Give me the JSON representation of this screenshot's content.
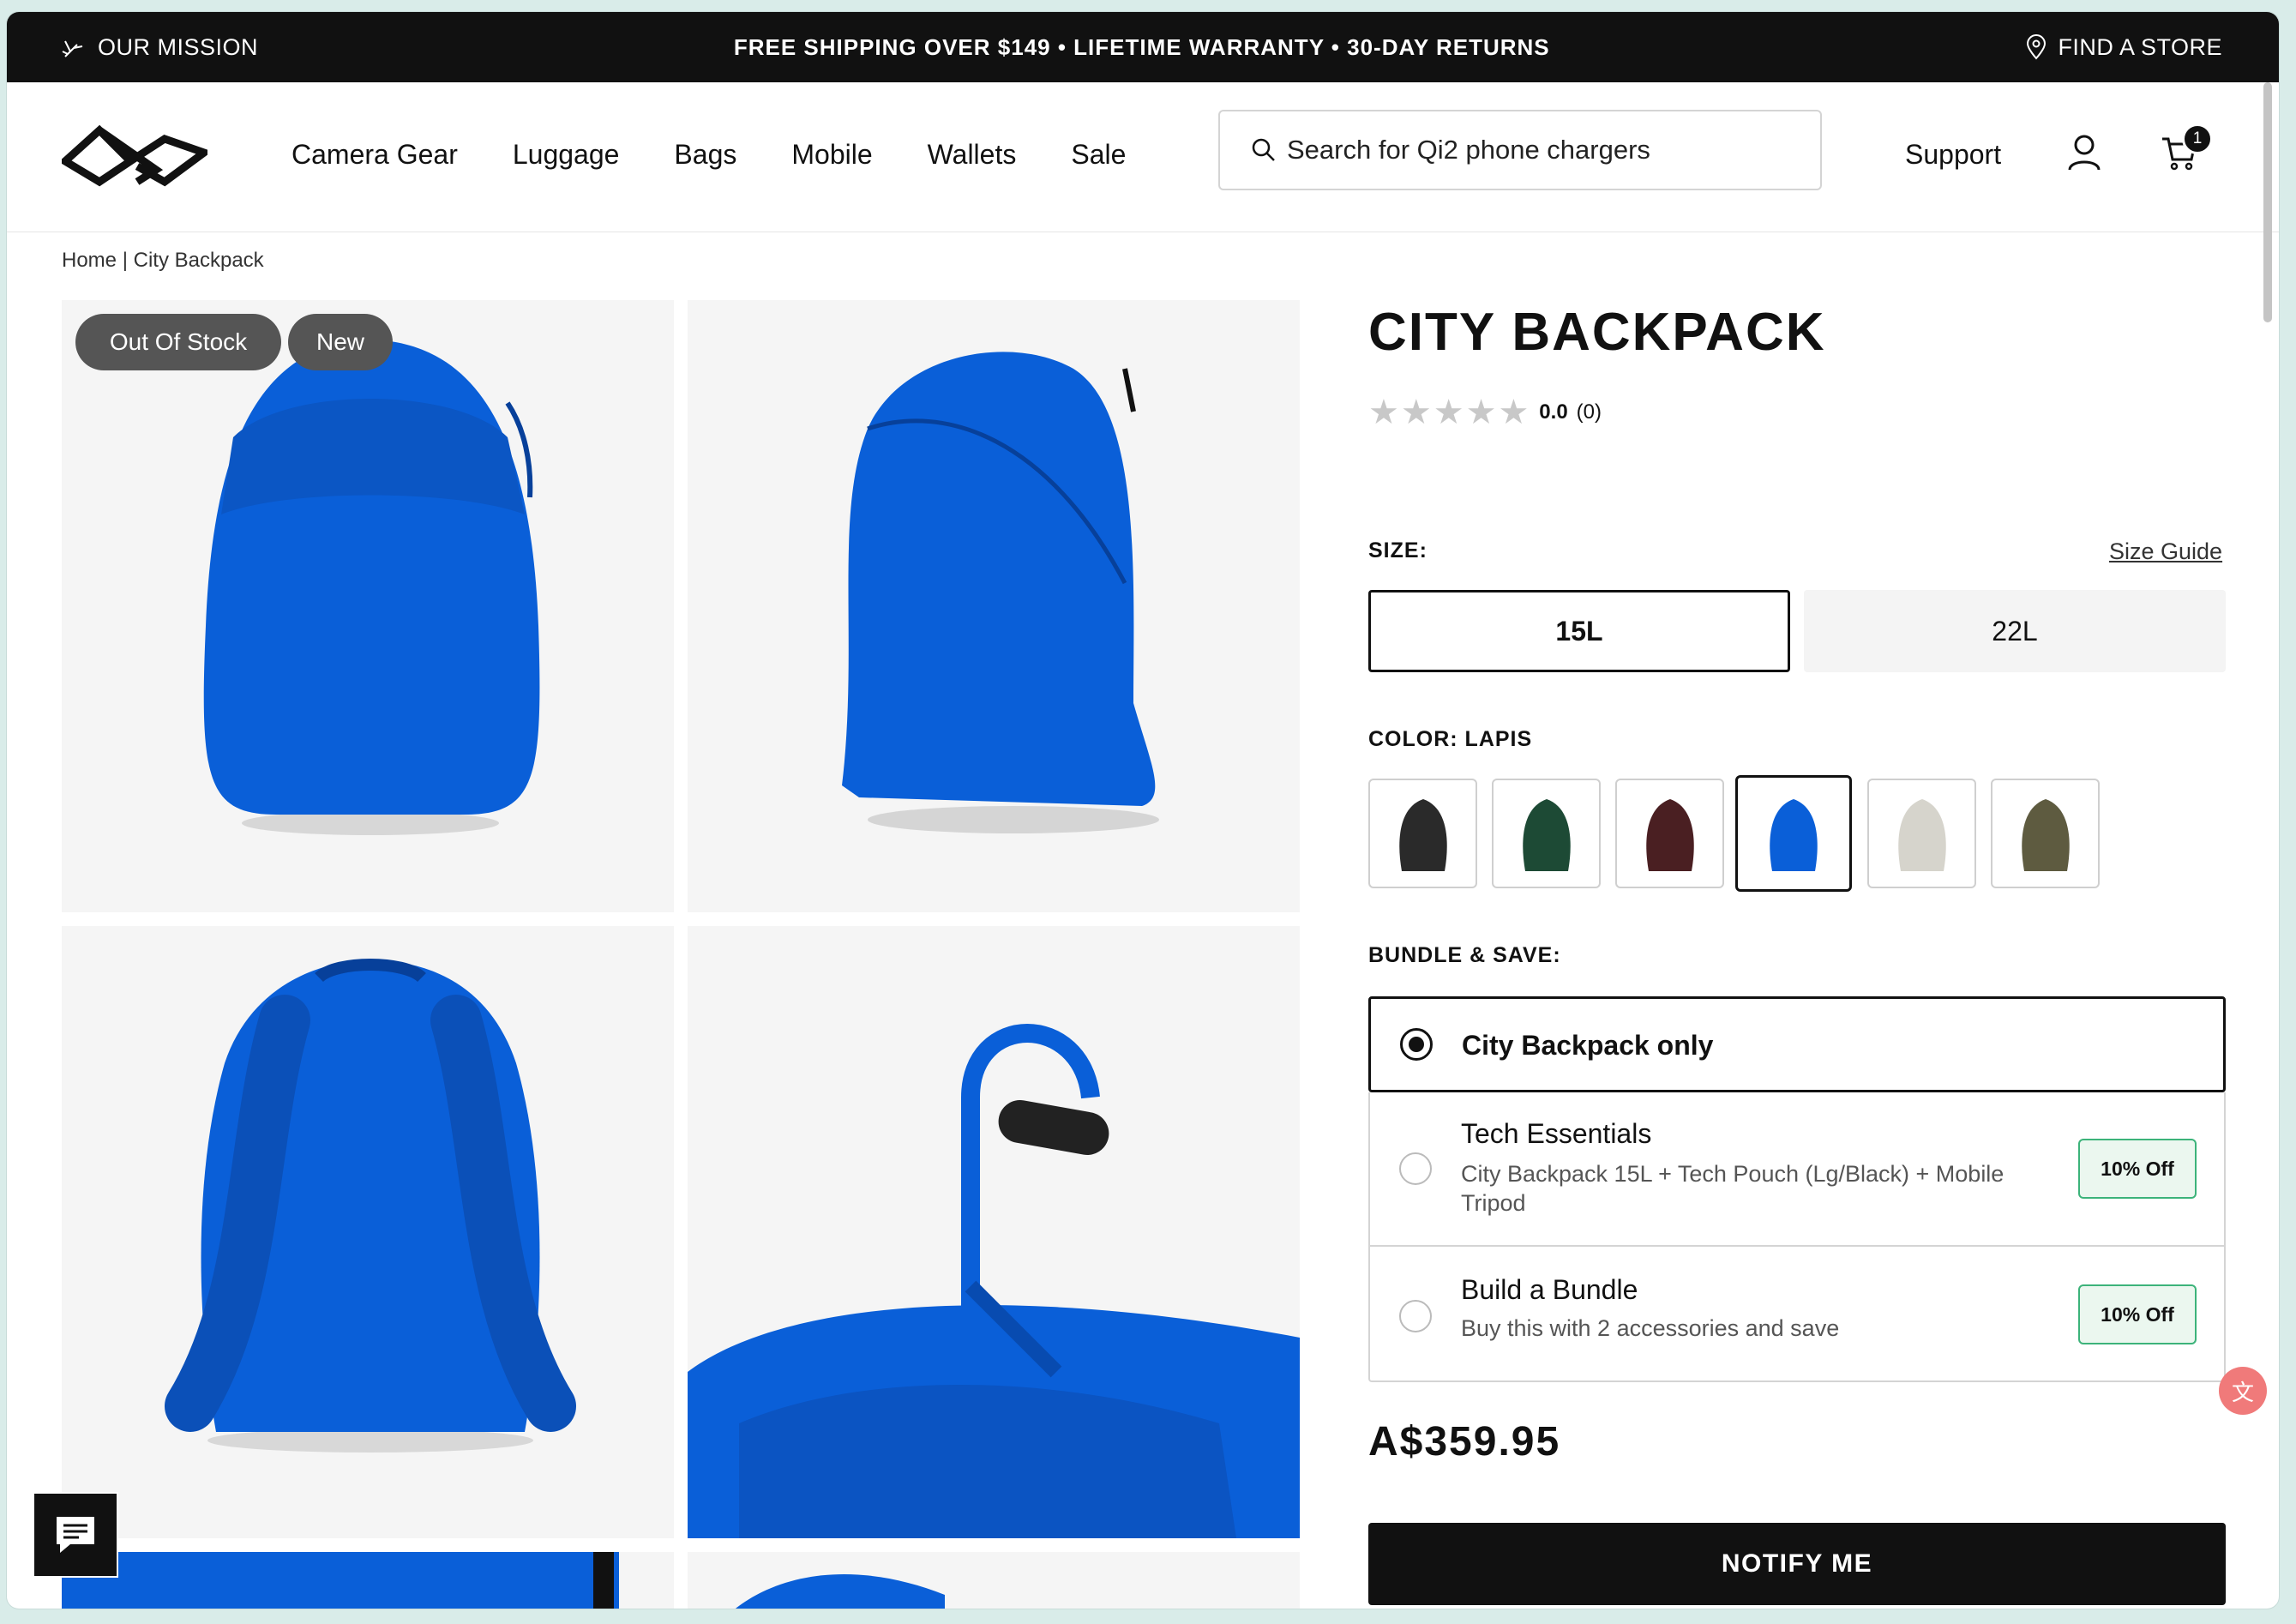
{
  "topbar": {
    "mission": "OUR MISSION",
    "promo": "FREE SHIPPING OVER $149 • LIFETIME WARRANTY • 30-DAY RETURNS",
    "store": "FIND A STORE"
  },
  "nav": [
    "Camera Gear",
    "Luggage",
    "Bags",
    "Mobile",
    "Wallets",
    "Sale"
  ],
  "search": {
    "placeholder": "Search for Qi2 phone chargers"
  },
  "header": {
    "support": "Support",
    "cart_count": "1"
  },
  "breadcrumb": {
    "home": "Home",
    "separator": "|",
    "current": "City Backpack"
  },
  "badges": {
    "out_of_stock": "Out Of Stock",
    "new": "New"
  },
  "product": {
    "title": "CITY BACKPACK",
    "rating_value": "0.0",
    "rating_count": "(0)",
    "stars": "★★★★★",
    "size_label": "SIZE:",
    "size_guide": "Size Guide",
    "sizes": [
      "15L",
      "22L"
    ],
    "selected_size": "15L",
    "color_label": "COLOR: LAPIS",
    "swatch_colors": [
      "#2a2a2a",
      "#1d4a35",
      "#4a1f22",
      "#0a5fd8",
      "#d6d4cc",
      "#5e5b40"
    ],
    "bundle_label": "BUNDLE & SAVE:",
    "bundles": [
      {
        "title": "City Backpack only",
        "desc": "",
        "badge": ""
      },
      {
        "title": "Tech Essentials",
        "desc": "City Backpack 15L + Tech Pouch (Lg/Black) + Mobile Tripod",
        "badge": "10% Off"
      },
      {
        "title": "Build a Bundle",
        "desc": "Buy this with 2 accessories and save",
        "badge": "10% Off"
      }
    ],
    "price": "A$359.95",
    "notify": "NOTIFY ME"
  },
  "colors": {
    "topbar": "#111111",
    "accent_blue": "#0a5fd8",
    "badge_green": "#3cb37a"
  }
}
